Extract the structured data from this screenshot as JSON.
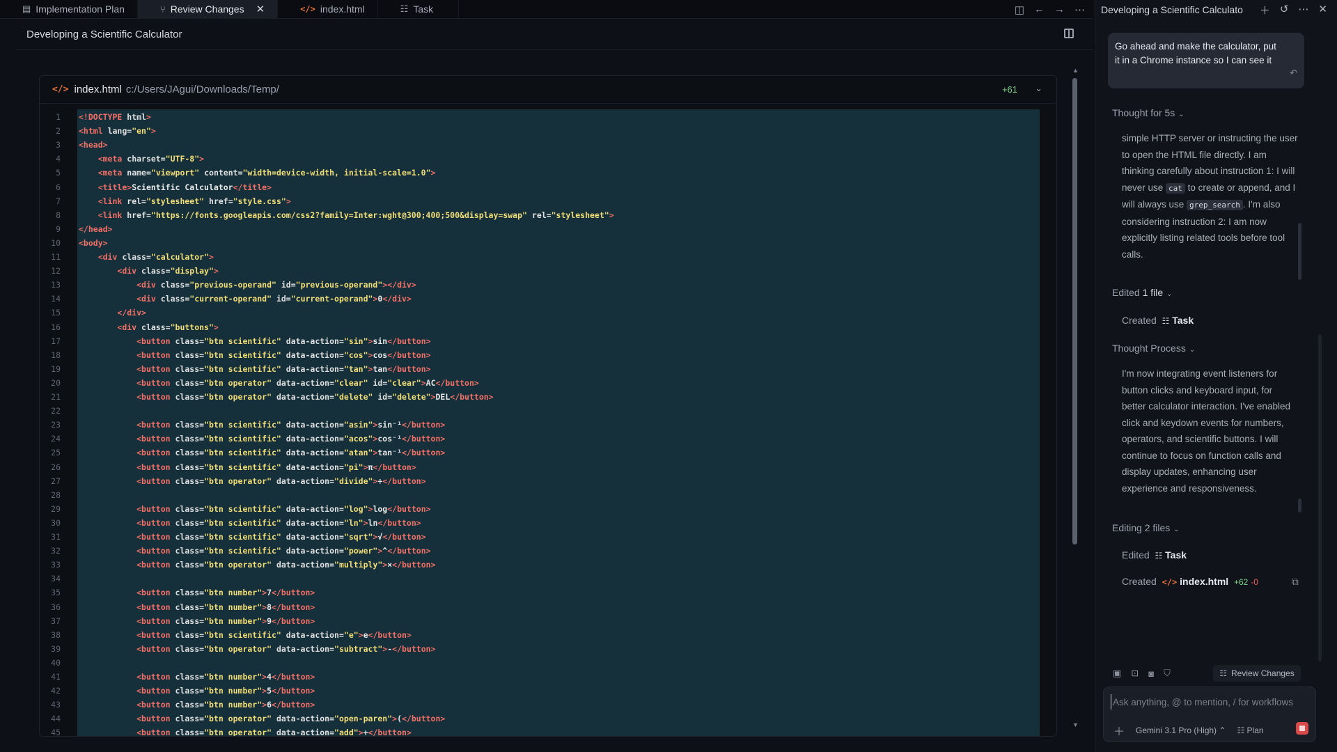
{
  "tabs": [
    {
      "label": "Implementation Plan",
      "icon": "document-icon",
      "active": false
    },
    {
      "label": "Review Changes",
      "icon": "diff-icon",
      "active": true
    },
    {
      "label": "index.html",
      "icon": "html-file-icon",
      "active": false
    },
    {
      "label": "Task",
      "icon": "checklist-icon",
      "active": false
    }
  ],
  "document": {
    "title": "Developing a Scientific Calculator"
  },
  "file": {
    "name": "index.html",
    "path": "c:/Users/JAgui/Downloads/Temp/",
    "added": "+61"
  },
  "code_lines": [
    "<!DOCTYPE html>",
    "<html lang=\"en\">",
    "<head>",
    "    <meta charset=\"UTF-8\">",
    "    <meta name=\"viewport\" content=\"width=device-width, initial-scale=1.0\">",
    "    <title>Scientific Calculator</title>",
    "    <link rel=\"stylesheet\" href=\"style.css\">",
    "    <link href=\"https://fonts.googleapis.com/css2?family=Inter:wght@300;400;500&display=swap\" rel=\"stylesheet\">",
    "</head>",
    "<body>",
    "    <div class=\"calculator\">",
    "        <div class=\"display\">",
    "            <div class=\"previous-operand\" id=\"previous-operand\"></div>",
    "            <div class=\"current-operand\" id=\"current-operand\">0</div>",
    "        </div>",
    "        <div class=\"buttons\">",
    "            <button class=\"btn scientific\" data-action=\"sin\">sin</button>",
    "            <button class=\"btn scientific\" data-action=\"cos\">cos</button>",
    "            <button class=\"btn scientific\" data-action=\"tan\">tan</button>",
    "            <button class=\"btn operator\" data-action=\"clear\" id=\"clear\">AC</button>",
    "            <button class=\"btn operator\" data-action=\"delete\" id=\"delete\">DEL</button>",
    "",
    "            <button class=\"btn scientific\" data-action=\"asin\">sin⁻¹</button>",
    "            <button class=\"btn scientific\" data-action=\"acos\">cos⁻¹</button>",
    "            <button class=\"btn scientific\" data-action=\"atan\">tan⁻¹</button>",
    "            <button class=\"btn scientific\" data-action=\"pi\">π</button>",
    "            <button class=\"btn operator\" data-action=\"divide\">÷</button>",
    "",
    "            <button class=\"btn scientific\" data-action=\"log\">log</button>",
    "            <button class=\"btn scientific\" data-action=\"ln\">ln</button>",
    "            <button class=\"btn scientific\" data-action=\"sqrt\">√</button>",
    "            <button class=\"btn scientific\" data-action=\"power\">^</button>",
    "            <button class=\"btn operator\" data-action=\"multiply\">×</button>",
    "",
    "            <button class=\"btn number\">7</button>",
    "            <button class=\"btn number\">8</button>",
    "            <button class=\"btn number\">9</button>",
    "            <button class=\"btn scientific\" data-action=\"e\">e</button>",
    "            <button class=\"btn operator\" data-action=\"subtract\">-</button>",
    "",
    "            <button class=\"btn number\">4</button>",
    "            <button class=\"btn number\">5</button>",
    "            <button class=\"btn number\">6</button>",
    "            <button class=\"btn operator\" data-action=\"open-paren\">(</button>",
    "            <button class=\"btn operator\" data-action=\"add\">+</button>"
  ],
  "agent": {
    "title": "Developing a Scientific Calculato",
    "user_message": "Go ahead and make the calculator, put it in a Chrome instance so I can see it",
    "thought1_label": "Thought for 5s",
    "thought1_text_a": "simple HTTP server or instructing the user to open the HTML file directly. I am thinking carefully about instruction 1: I will never use ",
    "thought1_chip1": "cat",
    "thought1_text_b": " to create or append, and I will always use ",
    "thought1_chip2": "grep_search",
    "thought1_text_c": ". I'm also considering instruction 2: I am now explicitly listing related tools before tool calls.",
    "edited_label": "Edited",
    "edited_count": "1 file",
    "created_label": "Created",
    "created_item": "Task",
    "thought2_label": "Thought Process",
    "thought2_text": "I'm now integrating event listeners for button clicks and keyboard input, for better calculator interaction. I've enabled click and keydown events for numbers, operators, and scientific buttons. I will continue to focus on function calls and display updates, enhancing user experience and responsiveness.",
    "editing_label": "Editing 2 files",
    "edited2_label": "Edited",
    "edited2_item": "Task",
    "created2_label": "Created",
    "created2_item": "index.html",
    "created2_plus": "+62",
    "created2_minus": "-0",
    "review_button": "Review Changes",
    "input_placeholder": "Ask anything, @ to mention, / for workflows",
    "model": "Gemini 3.1 Pro (High)",
    "mode": "Plan"
  }
}
